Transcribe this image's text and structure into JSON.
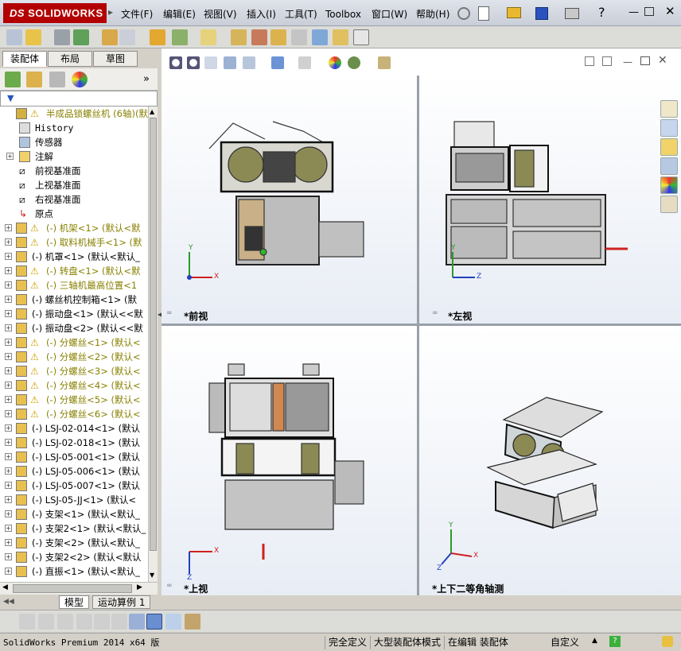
{
  "app": {
    "logo_prefix": "DS",
    "logo_text": "SOLIDWORKS"
  },
  "menu": [
    "文件(F)",
    "编辑(E)",
    "视图(V)",
    "插入(I)",
    "工具(T)",
    "Toolbox",
    "窗口(W)",
    "帮助(H)"
  ],
  "panel_tabs": [
    "装配体",
    "布局",
    "草图"
  ],
  "tree": [
    {
      "label": "半成品锁螺丝机 (6轴)",
      "suffix": "(默",
      "warn": true,
      "kind": "asm",
      "expand": false
    },
    {
      "label": "History",
      "kind": "history",
      "expand": false,
      "indent": 1
    },
    {
      "label": "传感器",
      "kind": "sensor",
      "expand": false,
      "indent": 1
    },
    {
      "label": "注解",
      "kind": "annot",
      "expand": true,
      "indent": 1
    },
    {
      "label": "前视基准面",
      "kind": "plane",
      "expand": false,
      "indent": 1
    },
    {
      "label": "上视基准面",
      "kind": "plane",
      "expand": false,
      "indent": 1
    },
    {
      "label": "右视基准面",
      "kind": "plane",
      "expand": false,
      "indent": 1
    },
    {
      "label": "原点",
      "kind": "origin",
      "expand": false,
      "indent": 1
    },
    {
      "label": "(-) 机架<1> (默认<默",
      "warn": true,
      "kind": "part",
      "expand": true
    },
    {
      "label": "(-) 取料机械手<1> (默",
      "warn": true,
      "kind": "part",
      "expand": true
    },
    {
      "label": "(-) 机罩<1> (默认<默认_",
      "warn": false,
      "kind": "part",
      "expand": true
    },
    {
      "label": "(-) 转盘<1> (默认<默",
      "warn": true,
      "kind": "part",
      "expand": true
    },
    {
      "label": "(-) 三轴机最高位置<1",
      "warn": true,
      "kind": "part",
      "expand": true
    },
    {
      "label": "(-) 螺丝机控制箱<1> (默",
      "warn": false,
      "kind": "part",
      "expand": true
    },
    {
      "label": "(-) 振动盘<1> (默认<<默",
      "warn": false,
      "kind": "part",
      "expand": true
    },
    {
      "label": "(-) 振动盘<2> (默认<<默",
      "warn": false,
      "kind": "part",
      "expand": true
    },
    {
      "label": "(-) 分螺丝<1> (默认<",
      "warn": true,
      "kind": "part",
      "expand": true
    },
    {
      "label": "(-) 分螺丝<2> (默认<",
      "warn": true,
      "kind": "part",
      "expand": true
    },
    {
      "label": "(-) 分螺丝<3> (默认<",
      "warn": true,
      "kind": "part",
      "expand": true
    },
    {
      "label": "(-) 分螺丝<4> (默认<",
      "warn": true,
      "kind": "part",
      "expand": true
    },
    {
      "label": "(-) 分螺丝<5> (默认<",
      "warn": true,
      "kind": "part",
      "expand": true
    },
    {
      "label": "(-) 分螺丝<6> (默认<",
      "warn": true,
      "kind": "part",
      "expand": true
    },
    {
      "label": "(-) LSJ-02-014<1> (默认",
      "warn": false,
      "kind": "part",
      "expand": true
    },
    {
      "label": "(-) LSJ-02-018<1> (默认",
      "warn": false,
      "kind": "part",
      "expand": true
    },
    {
      "label": "(-) LSJ-05-001<1> (默认",
      "warn": false,
      "kind": "part",
      "expand": true
    },
    {
      "label": "(-) LSJ-05-006<1> (默认",
      "warn": false,
      "kind": "part",
      "expand": true
    },
    {
      "label": "(-) LSJ-05-007<1> (默认",
      "warn": false,
      "kind": "part",
      "expand": true
    },
    {
      "label": "(-) LSJ-05-JJ<1> (默认<",
      "warn": false,
      "kind": "part",
      "expand": true
    },
    {
      "label": "(-) 支架<1> (默认<默认_",
      "warn": false,
      "kind": "part",
      "expand": true
    },
    {
      "label": "(-) 支架2<1> (默认<默认_",
      "warn": false,
      "kind": "part",
      "expand": true
    },
    {
      "label": "(-) 支架<2> (默认<默认_",
      "warn": false,
      "kind": "part",
      "expand": true
    },
    {
      "label": "(-) 支架2<2> (默认<默认",
      "warn": false,
      "kind": "part",
      "expand": true
    },
    {
      "label": "(-) 直振<1> (默认<默认_",
      "warn": false,
      "kind": "part",
      "expand": true
    }
  ],
  "viewports": {
    "front": "*前视",
    "left": "*左视",
    "top": "*上视",
    "iso": "*上下二等角轴测"
  },
  "axes": {
    "y": "Y",
    "x": "X",
    "z": "Z"
  },
  "bottom_tabs": [
    "模型",
    "运动算例 1"
  ],
  "status": {
    "product": "SolidWorks Premium 2014 x64 版",
    "defined": "完全定义",
    "mode": "大型装配体模式",
    "editing": "在编辑 装配体",
    "custom": "自定义",
    "help": "?"
  }
}
